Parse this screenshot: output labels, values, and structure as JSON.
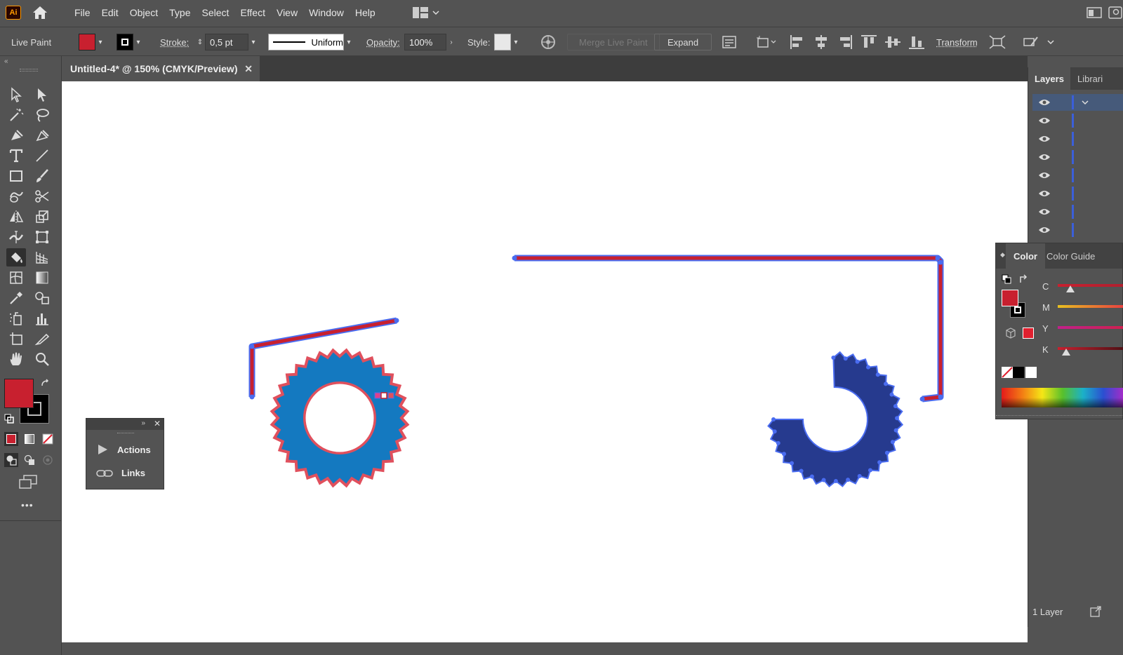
{
  "app": {
    "logo_text": "Ai"
  },
  "menu": [
    "File",
    "Edit",
    "Object",
    "Type",
    "Select",
    "Effect",
    "View",
    "Window",
    "Help"
  ],
  "control_bar": {
    "mode_label": "Live Paint",
    "stroke_label": "Stroke:",
    "stroke_value": "0,5 pt",
    "profile_label": "Uniform",
    "opacity_label": "Opacity:",
    "opacity_value": "100%",
    "style_label": "Style:",
    "merge_label": "Merge Live Paint",
    "expand_label": "Expand",
    "transform_label": "Transform",
    "fill_color": "#c8202f"
  },
  "document_tab": {
    "title": "Untitled-4* @ 150% (CMYK/Preview)",
    "close_glyph": "✕"
  },
  "toolbar": {
    "more_glyph": "•••",
    "fill_color": "#c8202f"
  },
  "mini_panel": {
    "items": [
      {
        "label": "Actions",
        "icon": "play-icon"
      },
      {
        "label": "Links",
        "icon": "link-icon"
      }
    ]
  },
  "layers_panel": {
    "tabs": [
      "Layers",
      "Librari"
    ],
    "footer": "1 Layer",
    "row_count": 8
  },
  "color_panel": {
    "tabs": [
      "Color",
      "Color Guide"
    ],
    "sliders": [
      {
        "label": "C"
      },
      {
        "label": "M"
      },
      {
        "label": "Y"
      },
      {
        "label": "K"
      }
    ]
  },
  "colors": {
    "accent_red": "#c8202f",
    "gear_blue": "#1479c0",
    "gear_navy": "#263a8e",
    "selection_blue": "#4a6cf0",
    "stroke_pink": "#e0505d"
  }
}
